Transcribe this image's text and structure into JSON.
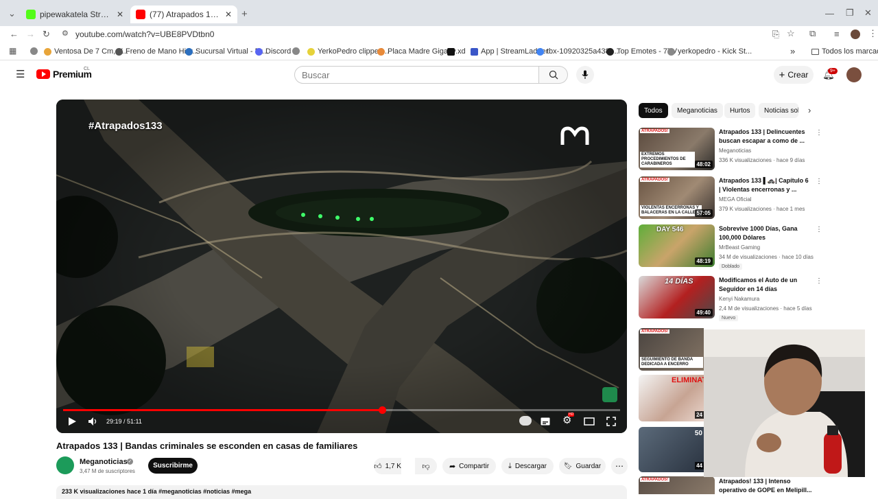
{
  "browser": {
    "tabs": [
      {
        "title": "pipewakatela Stream - Watch L",
        "active": false
      },
      {
        "title": "(77) Atrapados 133 | Bandas cri",
        "active": true
      }
    ],
    "new_tab": "+",
    "url": "youtube.com/watch?v=UBE8PVDtbn0",
    "bookmarks": [
      "Ventosa De 7 Cm, V...",
      "Freno de Mano Hidr...",
      "Sucursal Virtual - Pr...",
      "Discord",
      "YerkoPedro clipped...",
      "Placa Madre Gigaby...",
      "xd",
      "App | StreamLadder",
      "tbx-10920325a438-...",
      "Top Emotes - 7TV",
      "yerkopedro - Kick St..."
    ],
    "bookmarks_more": "»",
    "all_bookmarks": "Todos los marcadores"
  },
  "youtube": {
    "logo_text": "Premium",
    "logo_region": "CL",
    "search_placeholder": "Buscar",
    "create_label": "Crear",
    "notifications_badge": "9+"
  },
  "video": {
    "hashtag_overlay": "#Atrapados133",
    "time": "29:19 / 51:11",
    "progress": 0.573,
    "title": "Atrapados 133 | Bandas criminales se esconden en casas de familiares",
    "channel": "Meganoticias",
    "subscribers": "3,47 M de suscriptores",
    "subscribe_label": "Suscribirme",
    "likes": "1,7 K",
    "share_label": "Compartir",
    "download_label": "Descargar",
    "save_label": "Guardar",
    "description_meta": "233 K visualizaciones  hace 1 día  #meganoticias #noticias #mega"
  },
  "sidebar": {
    "chips": [
      "Todos",
      "Meganoticias",
      "Hurtos",
      "Noticias sol"
    ],
    "recommendations": [
      {
        "title": "Atrapados 133 | Delincuentes buscan escapar a como de ...",
        "channel": "Meganoticias",
        "meta": "336 K visualizaciones · hace 9 días",
        "duration": "48:02",
        "thumb_caption": "EXTREMOS PROCEDIMIENTOS DE CARABINEROS",
        "badge": ""
      },
      {
        "title": "Atrapados 133 ▌🚓| Capítulo 6 | Violentas encerronas y ...",
        "channel": "MEGA Oficial",
        "meta": "379 K visualizaciones · hace 1 mes",
        "duration": "57:05",
        "thumb_caption": "VIOLENTAS ENCERRONAS Y BALACERAS EN LA CALLE",
        "badge": ""
      },
      {
        "title": "Sobrevive 1000 Días, Gana 100,000 Dólares",
        "channel": "MrBeast Gaming",
        "meta": "34 M de visualizaciones · hace 10 días",
        "duration": "48:19",
        "thumb_caption": "DAY 546",
        "badge": "Doblado"
      },
      {
        "title": "Modificamos el Auto de un Seguidor en 14 días",
        "channel": "Kenyi Nakamura",
        "meta": "2,4 M de visualizaciones · hace 5 días",
        "duration": "49:40",
        "thumb_caption": "14 DÍAS",
        "badge": "Nuevo"
      }
    ],
    "partial_thumb_captions": [
      "SEGUIMIENTO DE BANDA DEDICADA A ENCERRO",
      "ELIMINAT",
      "50"
    ],
    "partial_durations": [
      "24",
      "44"
    ],
    "bottom_title": "Atrapados! 133 | Intenso operativo de GOPE en Melipill..."
  }
}
